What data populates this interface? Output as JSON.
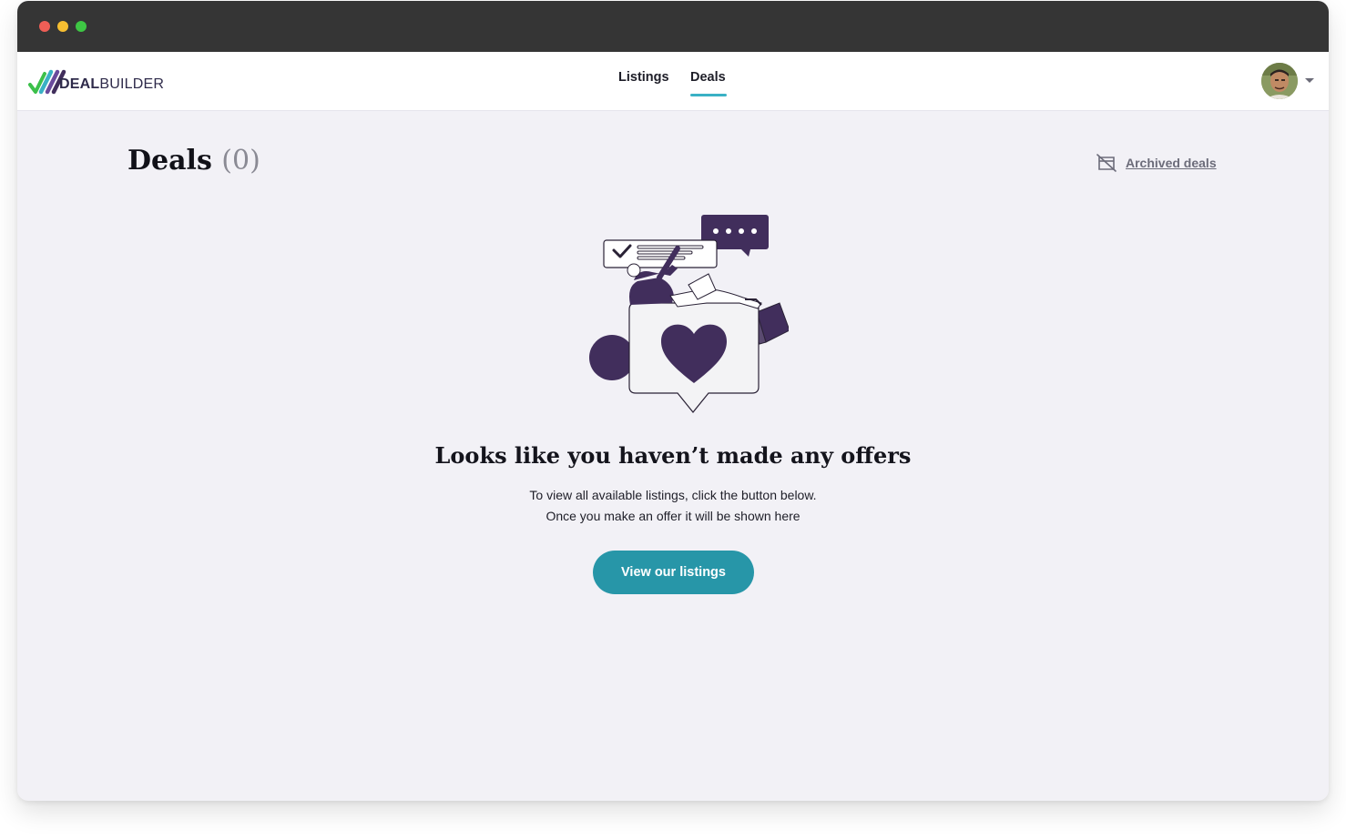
{
  "app": {
    "logo_bold": "DEAL",
    "logo_light": "BUILDER"
  },
  "nav": {
    "items": [
      {
        "label": "Listings",
        "active": false
      },
      {
        "label": "Deals",
        "active": true
      }
    ],
    "active_color": "#3ab1c5"
  },
  "user": {
    "avatar": "user-avatar-photo",
    "menu_icon": "chevron-down-icon"
  },
  "page": {
    "title": "Deals",
    "count": "(0)"
  },
  "archived": {
    "icon": "archive-off-icon",
    "label": "Archived deals"
  },
  "empty_state": {
    "illustration": "heart-chat-illustration",
    "title": "Looks like you haven’t made any offers",
    "line1": "To view all available listings, click the button below.",
    "line2": "Once you make an offer it will be shown here",
    "button_label": "View our listings",
    "button_color": "#2796a8",
    "accent_color": "#412e5c"
  }
}
